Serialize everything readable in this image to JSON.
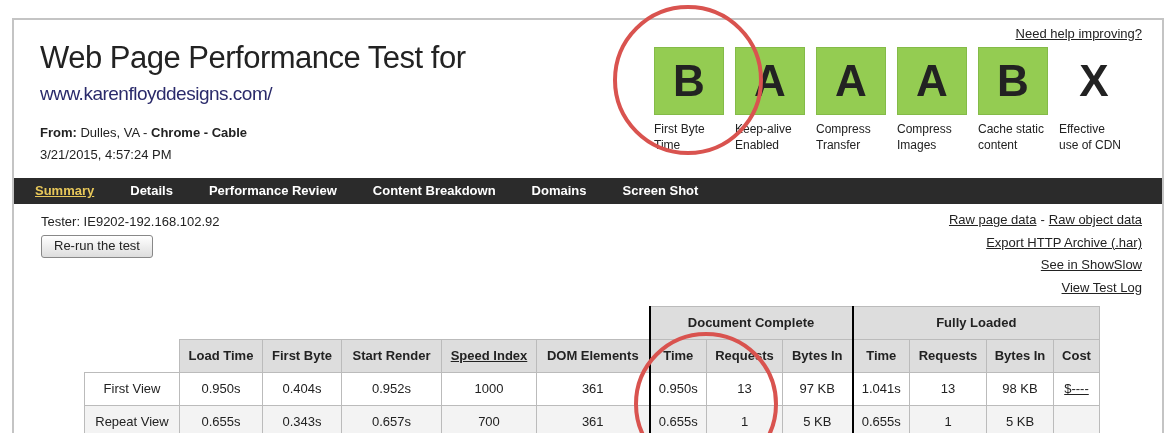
{
  "header": {
    "title": "Web Page Performance Test for",
    "url": "www.karenfloyddesigns.com/",
    "location": "**From:** Dulles, VA - **Chrome - Cable**",
    "date": "3/21/2015, 4:57:24 PM"
  },
  "help_link": "Need help improving?",
  "grades": [
    {
      "kind": "scored",
      "letter": "B",
      "label": "First Byte Time"
    },
    {
      "kind": "scored",
      "letter": "A",
      "label": "Keep-alive Enabled"
    },
    {
      "kind": "scored",
      "letter": "A",
      "label": "Compress Transfer"
    },
    {
      "kind": "scored",
      "letter": "A",
      "label": "Compress Images"
    },
    {
      "kind": "scored",
      "letter": "B",
      "label": "Cache static content"
    },
    {
      "kind": "none",
      "letter": "X",
      "label": "Effective use of CDN"
    }
  ],
  "nav": [
    {
      "label": "Summary",
      "selected": true
    },
    {
      "label": "Details",
      "selected": false
    },
    {
      "label": "Performance Review",
      "selected": false
    },
    {
      "label": "Content Breakdown",
      "selected": false
    },
    {
      "label": "Domains",
      "selected": false
    },
    {
      "label": "Screen Shot",
      "selected": false
    }
  ],
  "tester": "Tester: IE9202-192.168.102.92",
  "rerun_button": "Re-run the test",
  "links": [
    [
      "Raw page data",
      "-",
      "Raw object data"
    ],
    [
      "Export HTTP Archive (.har)"
    ],
    [
      "See in ShowSlow"
    ],
    [
      "View Test Log"
    ]
  ],
  "table": {
    "groups": [
      "Document Complete",
      "Fully Loaded"
    ],
    "columns": [
      {
        "label": "Load Time",
        "link": false
      },
      {
        "label": "First Byte",
        "link": false
      },
      {
        "label": "Start Render",
        "link": false
      },
      {
        "label": "Speed Index",
        "link": true
      },
      {
        "label": "DOM Elements",
        "link": false
      },
      {
        "label": "Time",
        "link": false
      },
      {
        "label": "Requests",
        "link": false
      },
      {
        "label": "Bytes In",
        "link": false
      },
      {
        "label": "Time",
        "link": false
      },
      {
        "label": "Requests",
        "link": false
      },
      {
        "label": "Bytes In",
        "link": false
      },
      {
        "label": "Cost",
        "link": false
      }
    ],
    "rows": [
      {
        "label": "First View",
        "cells": [
          "0.950s",
          "0.404s",
          "0.952s",
          "1000",
          "361",
          "0.950s",
          "13",
          "97 KB",
          "1.041s",
          "13",
          "98 KB",
          "$----"
        ]
      },
      {
        "label": "Repeat View",
        "cells": [
          "0.655s",
          "0.343s",
          "0.657s",
          "700",
          "361",
          "0.655s",
          "1",
          "5 KB",
          "0.655s",
          "1",
          "5 KB",
          ""
        ]
      }
    ]
  }
}
